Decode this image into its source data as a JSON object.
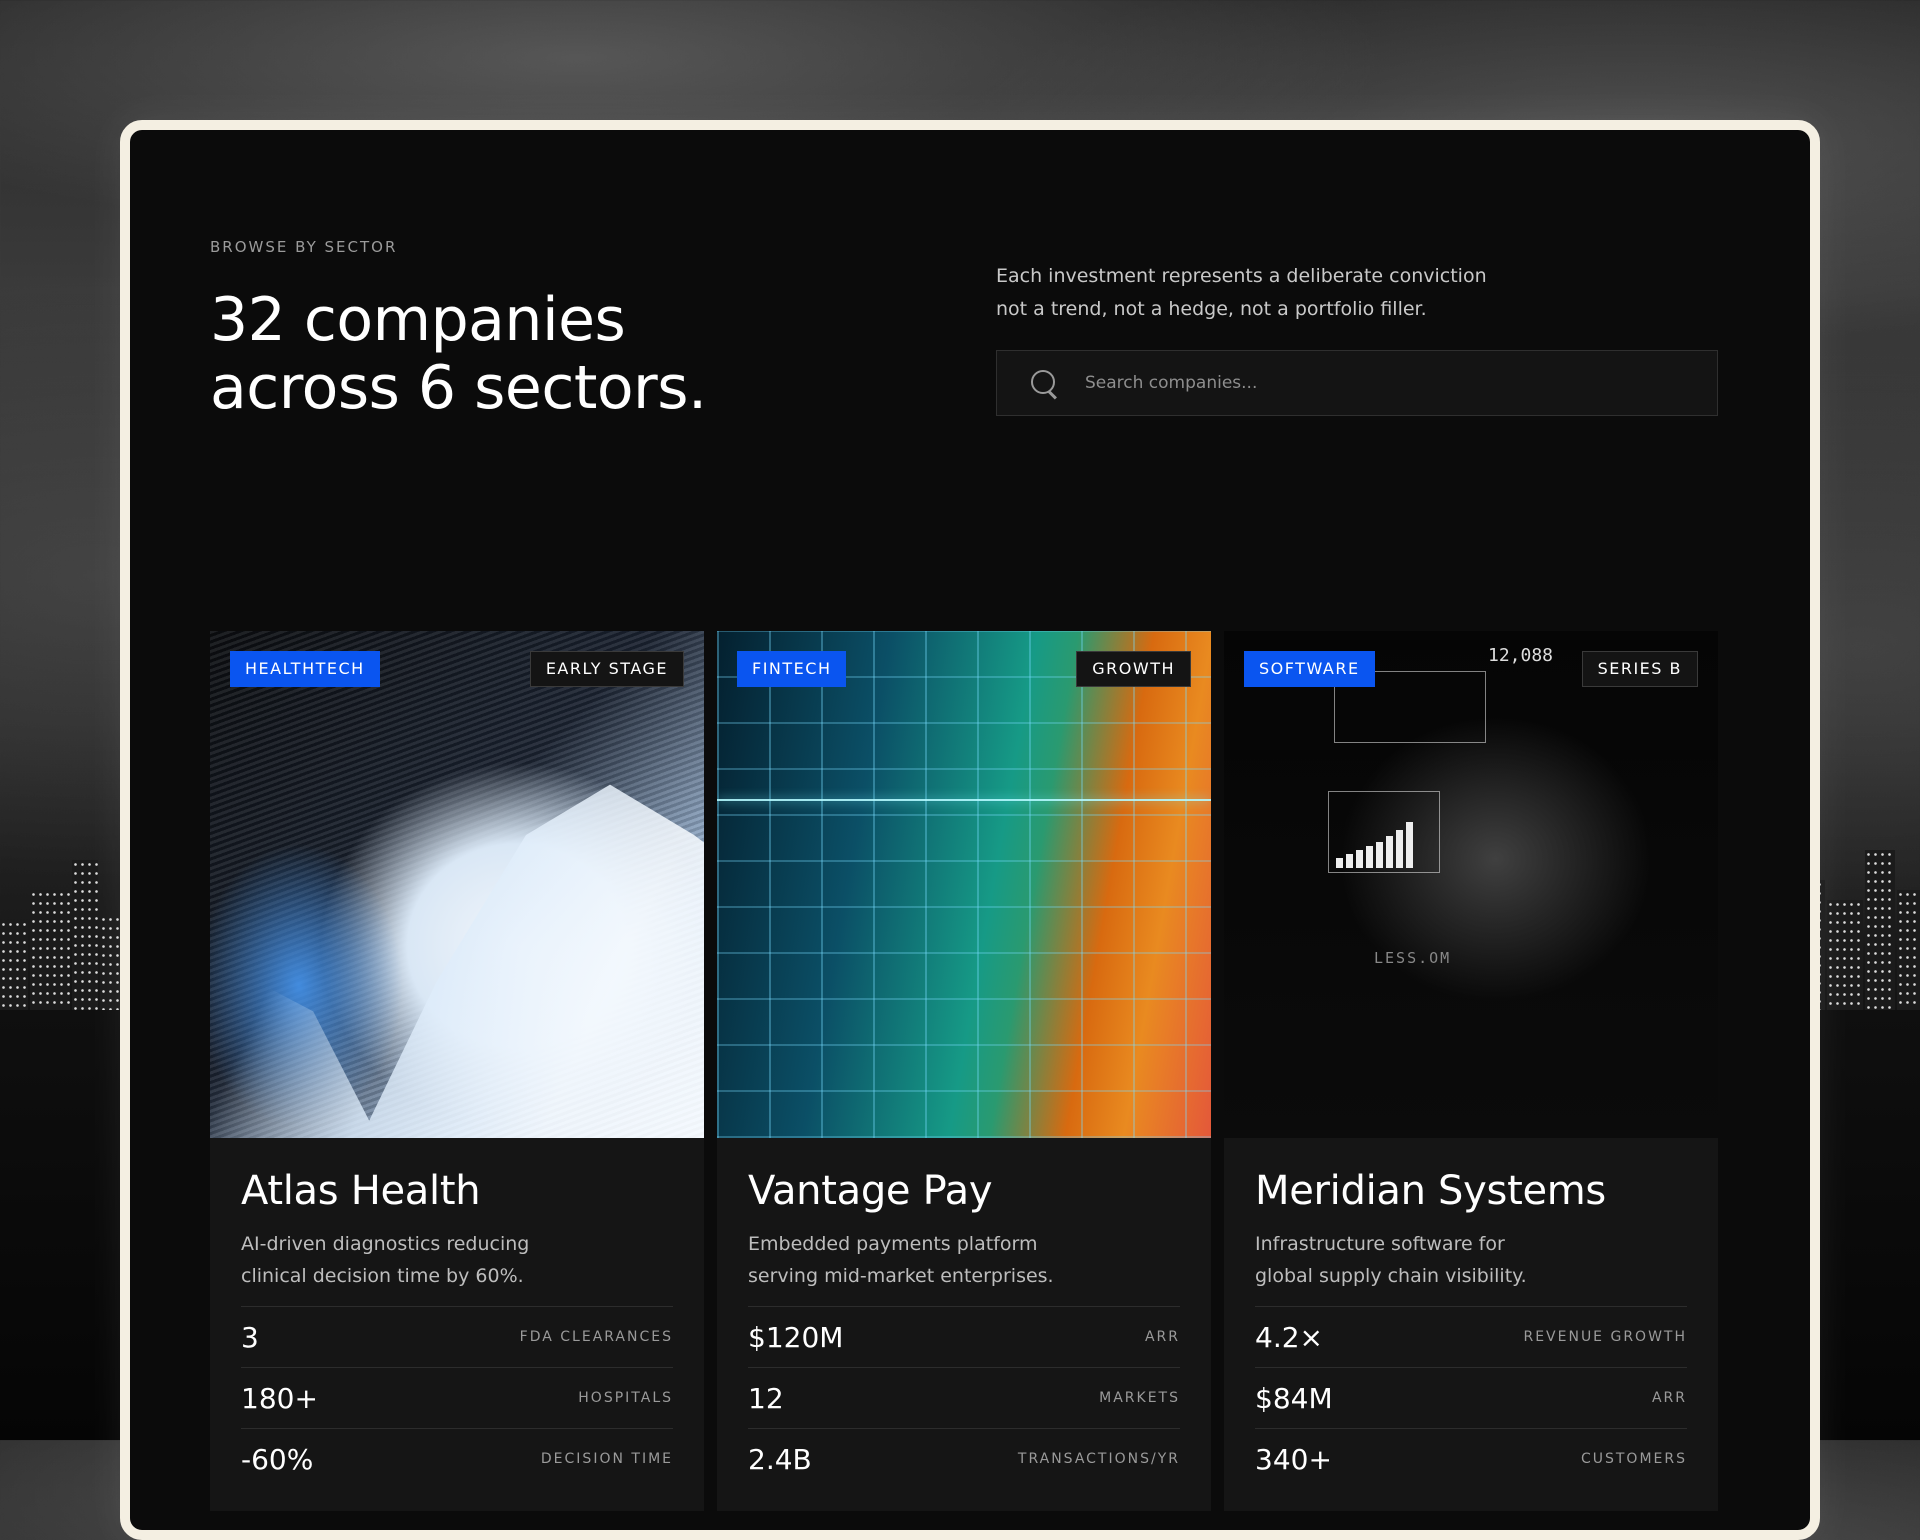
{
  "header": {
    "eyebrow": "BROWSE BY SECTOR",
    "headline_line1": "32 companies",
    "headline_line2": "across 6 sectors.",
    "intro_line1": "Each investment represents a deliberate conviction",
    "intro_line2": "not a trend, not a hedge, not a portfolio filler."
  },
  "search": {
    "placeholder": "Search companies...",
    "icon": "search-icon"
  },
  "colors": {
    "accent": "#0a55f0",
    "frame": "#f4efe2",
    "background": "#0b0b0b",
    "card": "#151515"
  },
  "cards": [
    {
      "sector": "HEALTHTECH",
      "stage": "EARLY STAGE",
      "name": "Atlas Health",
      "desc_line1": "AI-driven diagnostics reducing",
      "desc_line2": "clinical decision time by 60%.",
      "metrics": [
        {
          "value": "3",
          "label": "FDA CLEARANCES"
        },
        {
          "value": "180+",
          "label": "HOSPITALS"
        },
        {
          "value": "-60%",
          "label": "DECISION TIME"
        }
      ]
    },
    {
      "sector": "FINTECH",
      "stage": "GROWTH",
      "name": "Vantage Pay",
      "desc_line1": "Embedded payments platform",
      "desc_line2": "serving mid-market enterprises.",
      "metrics": [
        {
          "value": "$120M",
          "label": "ARR"
        },
        {
          "value": "12",
          "label": "MARKETS"
        },
        {
          "value": "2.4B",
          "label": "TRANSACTIONS/YR"
        }
      ]
    },
    {
      "sector": "SOFTWARE",
      "stage": "SERIES B",
      "name": "Meridian Systems",
      "desc_line1": "Infrastructure software for",
      "desc_line2": "global supply chain visibility.",
      "image_text": {
        "number": "12,088",
        "label": "LESS.OM"
      },
      "metrics": [
        {
          "value": "4.2×",
          "label": "REVENUE GROWTH"
        },
        {
          "value": "$84M",
          "label": "ARR"
        },
        {
          "value": "340+",
          "label": "CUSTOMERS"
        }
      ]
    }
  ]
}
